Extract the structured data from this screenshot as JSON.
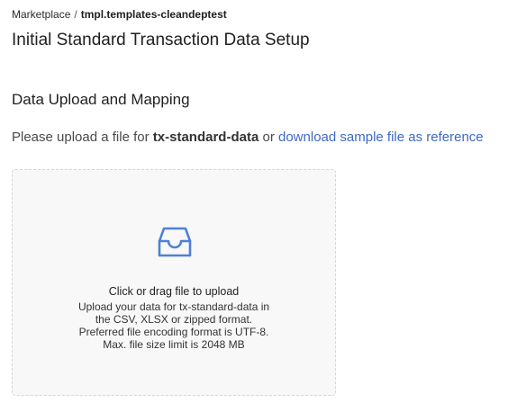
{
  "breadcrumb": {
    "root": "Marketplace",
    "separator": "/",
    "current": "tmpl.templates-cleandeptest"
  },
  "page": {
    "title": "Initial Standard Transaction Data Setup"
  },
  "section": {
    "title": "Data Upload and Mapping",
    "prompt_prefix": "Please upload a file for",
    "dataset_name": "tx-standard-data",
    "prompt_middle": "or",
    "sample_link": "download sample file as reference"
  },
  "upload": {
    "icon": "inbox-icon",
    "title": "Click or drag file to upload",
    "hint_lines": [
      "Upload your data for tx-standard-data in",
      "the CSV, XLSX or zipped format.",
      "Preferred file encoding format is UTF-8.",
      "Max. file size limit is 2048 MB"
    ]
  },
  "colors": {
    "link": "#3f68c5",
    "icon": "#4f7fd6",
    "dropzone_bg": "#f8f8f8",
    "dropzone_border": "#d6d6d6"
  }
}
